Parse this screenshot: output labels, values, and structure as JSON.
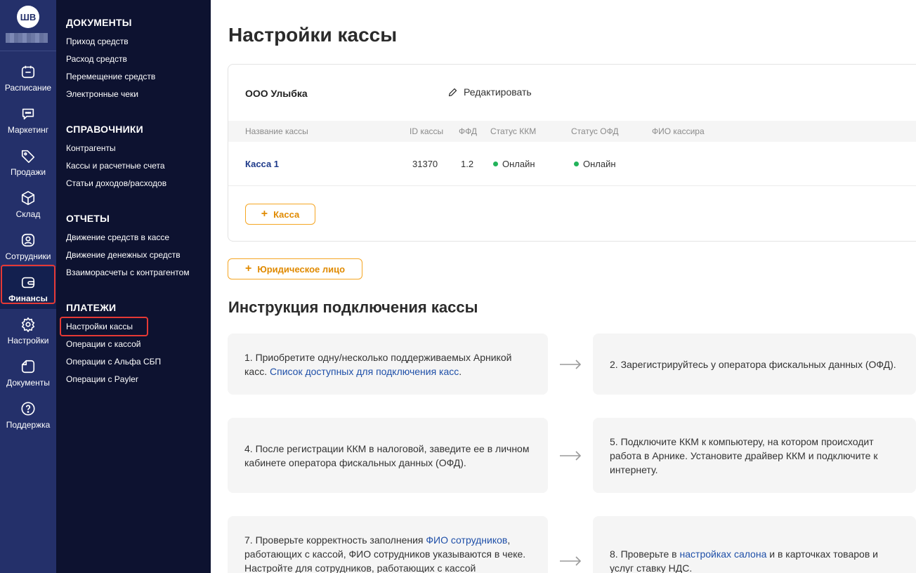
{
  "user": {
    "initials": "ШВ"
  },
  "rail": [
    {
      "label": "Расписание",
      "icon": "calendar-icon"
    },
    {
      "label": "Маркетинг",
      "icon": "chat-icon"
    },
    {
      "label": "Продажи",
      "icon": "tag-icon"
    },
    {
      "label": "Склад",
      "icon": "box-icon"
    },
    {
      "label": "Сотрудники",
      "icon": "user-icon"
    },
    {
      "label": "Финансы",
      "icon": "wallet-icon",
      "active": true
    },
    {
      "label": "Настройки",
      "icon": "gear-icon"
    },
    {
      "label": "Документы",
      "icon": "document-icon"
    },
    {
      "label": "Поддержка",
      "icon": "help-icon"
    }
  ],
  "submenu": {
    "groups": [
      {
        "title": "ДОКУМЕНТЫ",
        "items": [
          "Приход средств",
          "Расход средств",
          "Перемещение средств",
          "Электронные чеки"
        ]
      },
      {
        "title": "СПРАВОЧНИКИ",
        "items": [
          "Контрагенты",
          "Кассы и расчетные счета",
          "Статьи доходов/расходов"
        ]
      },
      {
        "title": "ОТЧЕТЫ",
        "items": [
          "Движение средств в кассе",
          "Движение денежных средств",
          "Взаиморасчеты с контрагентом"
        ]
      },
      {
        "title": "ПЛАТЕЖИ",
        "items": [
          "Настройки кассы",
          "Операции с кассой",
          "Операции с Альфа СБП",
          "Операции с Payler"
        ]
      }
    ]
  },
  "page": {
    "title": "Настройки кассы"
  },
  "org": {
    "name": "ООО Улыбка",
    "edit_label": "Редактировать"
  },
  "table": {
    "headers": [
      "Название кассы",
      "ID кассы",
      "ФФД",
      "Статус ККМ",
      "Статус ОФД",
      "ФИО кассира"
    ],
    "rows": [
      {
        "name": "Касса 1",
        "id": "31370",
        "ffd": "1.2",
        "kkm_status": "Онлайн",
        "ofd_status": "Онлайн",
        "cashier": ""
      }
    ]
  },
  "buttons": {
    "add_kassa": "Касса",
    "add_legal": "Юридическое лицо"
  },
  "instructions": {
    "title": "Инструкция подключения кассы",
    "steps": {
      "s1_text": "1. Приобретите одну/несколько поддерживаемых Арникой касс. ",
      "s1_link": "Список доступных для подключения касс",
      "s1_after": ".",
      "s2_text": "2. Зарегистрируйтесь у оператора фискальных данных (ОФД).",
      "s4_text": "4. После регистрации ККМ в налоговой, заведите ее в личном кабинете оператора фискальных данных (ОФД).",
      "s5_text": "5. Подключите ККМ к компьютеру, на котором происходит работа в Арнике. Установите драйвер ККМ и подключите к интернету.",
      "s7_text": "7. Проверьте корректность заполнения ",
      "s7_link": "ФИО сотрудников",
      "s7_after": ", работающих с кассой, ФИО сотрудников указываются в чеке. Настройте для сотрудников, работающих с кассой",
      "s8_text": "8. Проверьте в ",
      "s8_link": "настройках салона",
      "s8_after": " и в карточках товаров и услуг ставку НДС."
    }
  },
  "colors": {
    "rail": "#24306a",
    "panel": "#0d1230",
    "accent": "#f5a623",
    "link": "#1e3a8a",
    "online": "#22b35a",
    "highlight": "#e53935"
  }
}
